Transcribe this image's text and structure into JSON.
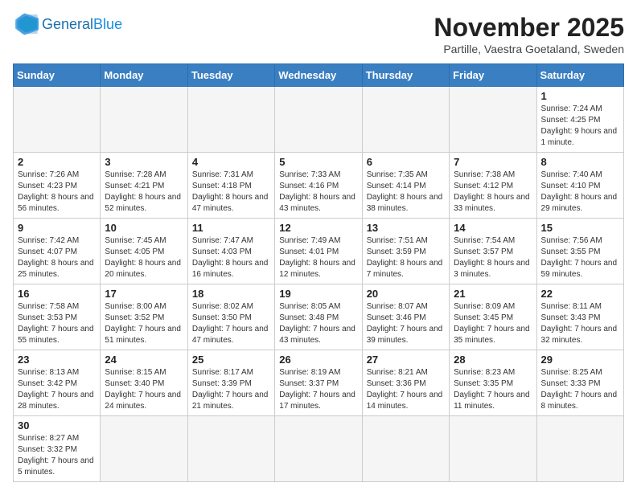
{
  "header": {
    "logo_general": "General",
    "logo_blue": "Blue",
    "month_title": "November 2025",
    "location": "Partille, Vaestra Goetaland, Sweden"
  },
  "weekdays": [
    "Sunday",
    "Monday",
    "Tuesday",
    "Wednesday",
    "Thursday",
    "Friday",
    "Saturday"
  ],
  "weeks": [
    [
      {
        "day": "",
        "info": ""
      },
      {
        "day": "",
        "info": ""
      },
      {
        "day": "",
        "info": ""
      },
      {
        "day": "",
        "info": ""
      },
      {
        "day": "",
        "info": ""
      },
      {
        "day": "",
        "info": ""
      },
      {
        "day": "1",
        "info": "Sunrise: 7:24 AM\nSunset: 4:25 PM\nDaylight: 9 hours and 1 minute."
      }
    ],
    [
      {
        "day": "2",
        "info": "Sunrise: 7:26 AM\nSunset: 4:23 PM\nDaylight: 8 hours and 56 minutes."
      },
      {
        "day": "3",
        "info": "Sunrise: 7:28 AM\nSunset: 4:21 PM\nDaylight: 8 hours and 52 minutes."
      },
      {
        "day": "4",
        "info": "Sunrise: 7:31 AM\nSunset: 4:18 PM\nDaylight: 8 hours and 47 minutes."
      },
      {
        "day": "5",
        "info": "Sunrise: 7:33 AM\nSunset: 4:16 PM\nDaylight: 8 hours and 43 minutes."
      },
      {
        "day": "6",
        "info": "Sunrise: 7:35 AM\nSunset: 4:14 PM\nDaylight: 8 hours and 38 minutes."
      },
      {
        "day": "7",
        "info": "Sunrise: 7:38 AM\nSunset: 4:12 PM\nDaylight: 8 hours and 33 minutes."
      },
      {
        "day": "8",
        "info": "Sunrise: 7:40 AM\nSunset: 4:10 PM\nDaylight: 8 hours and 29 minutes."
      }
    ],
    [
      {
        "day": "9",
        "info": "Sunrise: 7:42 AM\nSunset: 4:07 PM\nDaylight: 8 hours and 25 minutes."
      },
      {
        "day": "10",
        "info": "Sunrise: 7:45 AM\nSunset: 4:05 PM\nDaylight: 8 hours and 20 minutes."
      },
      {
        "day": "11",
        "info": "Sunrise: 7:47 AM\nSunset: 4:03 PM\nDaylight: 8 hours and 16 minutes."
      },
      {
        "day": "12",
        "info": "Sunrise: 7:49 AM\nSunset: 4:01 PM\nDaylight: 8 hours and 12 minutes."
      },
      {
        "day": "13",
        "info": "Sunrise: 7:51 AM\nSunset: 3:59 PM\nDaylight: 8 hours and 7 minutes."
      },
      {
        "day": "14",
        "info": "Sunrise: 7:54 AM\nSunset: 3:57 PM\nDaylight: 8 hours and 3 minutes."
      },
      {
        "day": "15",
        "info": "Sunrise: 7:56 AM\nSunset: 3:55 PM\nDaylight: 7 hours and 59 minutes."
      }
    ],
    [
      {
        "day": "16",
        "info": "Sunrise: 7:58 AM\nSunset: 3:53 PM\nDaylight: 7 hours and 55 minutes."
      },
      {
        "day": "17",
        "info": "Sunrise: 8:00 AM\nSunset: 3:52 PM\nDaylight: 7 hours and 51 minutes."
      },
      {
        "day": "18",
        "info": "Sunrise: 8:02 AM\nSunset: 3:50 PM\nDaylight: 7 hours and 47 minutes."
      },
      {
        "day": "19",
        "info": "Sunrise: 8:05 AM\nSunset: 3:48 PM\nDaylight: 7 hours and 43 minutes."
      },
      {
        "day": "20",
        "info": "Sunrise: 8:07 AM\nSunset: 3:46 PM\nDaylight: 7 hours and 39 minutes."
      },
      {
        "day": "21",
        "info": "Sunrise: 8:09 AM\nSunset: 3:45 PM\nDaylight: 7 hours and 35 minutes."
      },
      {
        "day": "22",
        "info": "Sunrise: 8:11 AM\nSunset: 3:43 PM\nDaylight: 7 hours and 32 minutes."
      }
    ],
    [
      {
        "day": "23",
        "info": "Sunrise: 8:13 AM\nSunset: 3:42 PM\nDaylight: 7 hours and 28 minutes."
      },
      {
        "day": "24",
        "info": "Sunrise: 8:15 AM\nSunset: 3:40 PM\nDaylight: 7 hours and 24 minutes."
      },
      {
        "day": "25",
        "info": "Sunrise: 8:17 AM\nSunset: 3:39 PM\nDaylight: 7 hours and 21 minutes."
      },
      {
        "day": "26",
        "info": "Sunrise: 8:19 AM\nSunset: 3:37 PM\nDaylight: 7 hours and 17 minutes."
      },
      {
        "day": "27",
        "info": "Sunrise: 8:21 AM\nSunset: 3:36 PM\nDaylight: 7 hours and 14 minutes."
      },
      {
        "day": "28",
        "info": "Sunrise: 8:23 AM\nSunset: 3:35 PM\nDaylight: 7 hours and 11 minutes."
      },
      {
        "day": "29",
        "info": "Sunrise: 8:25 AM\nSunset: 3:33 PM\nDaylight: 7 hours and 8 minutes."
      }
    ],
    [
      {
        "day": "30",
        "info": "Sunrise: 8:27 AM\nSunset: 3:32 PM\nDaylight: 7 hours and 5 minutes."
      },
      {
        "day": "",
        "info": ""
      },
      {
        "day": "",
        "info": ""
      },
      {
        "day": "",
        "info": ""
      },
      {
        "day": "",
        "info": ""
      },
      {
        "day": "",
        "info": ""
      },
      {
        "day": "",
        "info": ""
      }
    ]
  ]
}
